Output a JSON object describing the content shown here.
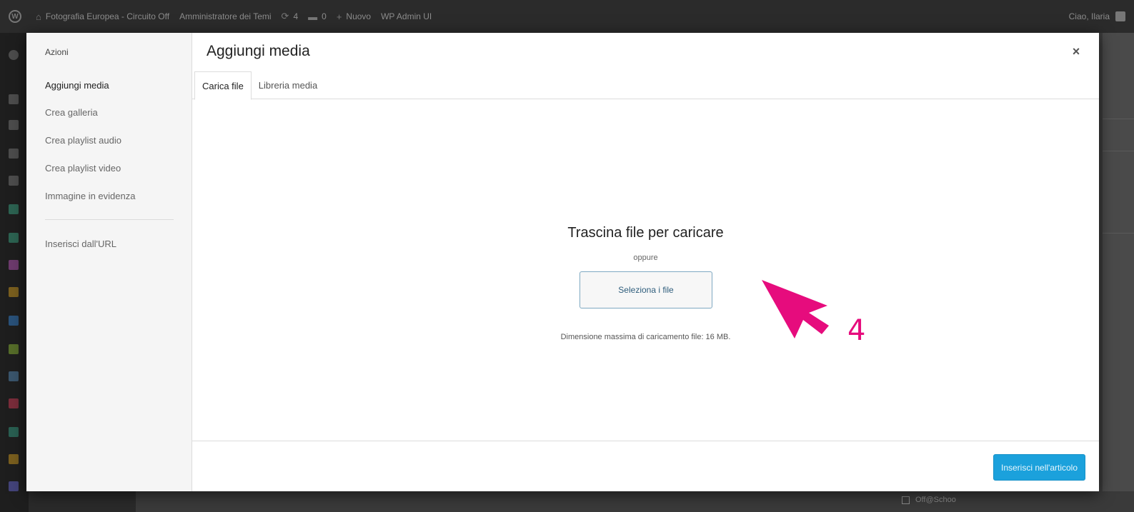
{
  "admin_bar": {
    "site_name": "Fotografia Europea - Circuito Off",
    "theme_admin": "Amministratore dei Temi",
    "updates_count": "4",
    "comments_count": "0",
    "new_label": "Nuovo",
    "wp_admin_ui": "WP Admin UI",
    "greeting": "Ciao, Ilaria"
  },
  "modal": {
    "menu": {
      "heading": "Azioni",
      "items": [
        "Aggiungi media",
        "Crea galleria",
        "Crea playlist audio",
        "Crea playlist video",
        "Immagine in evidenza"
      ],
      "insert_from_url": "Inserisci dall'URL"
    },
    "title": "Aggiungi media",
    "close_glyph": "×",
    "tabs": [
      "Carica file",
      "Libreria media"
    ],
    "uploader": {
      "drop_title": "Trascina file per caricare",
      "or": "oppure",
      "select_button": "Seleziona i file",
      "max_size": "Dimensione massima di caricamento file: 16 MB."
    },
    "insert_button": "Inserisci nell'articolo"
  },
  "background": {
    "checkbox_label": "Off@Schoo"
  },
  "annotation": {
    "step_number": "4",
    "color": "#e60c7d"
  },
  "colors": {
    "primary_button": "#1ba1dc",
    "admin_bar": "#2b2b2b"
  }
}
